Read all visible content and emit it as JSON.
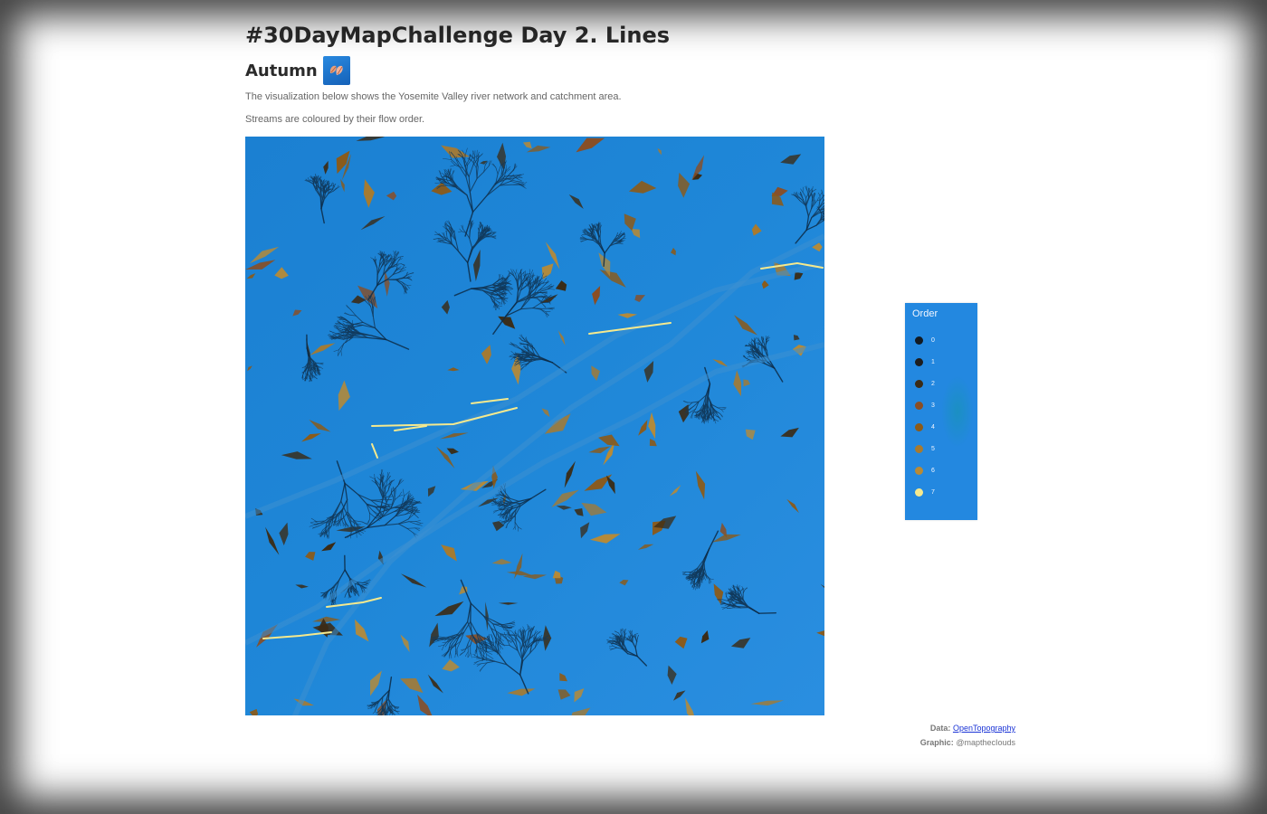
{
  "header": {
    "title": "#30DayMapChallenge Day 2. Lines",
    "subtitle": "Autumn",
    "badge_icon": "autumn-leaves-icon"
  },
  "description": {
    "line1": "The visualization below shows the Yosemite Valley river network and catchment area.",
    "line2": "Streams are coloured by their flow order."
  },
  "map": {
    "subject": "Yosemite Valley river network",
    "background_color": "#1f85d6",
    "stream_color": "#0f3450"
  },
  "legend": {
    "title": "Order",
    "items": [
      {
        "label": "0",
        "color": "#121a22"
      },
      {
        "label": "1",
        "color": "#1d1d1d"
      },
      {
        "label": "2",
        "color": "#3b2b15"
      },
      {
        "label": "3",
        "color": "#8a4e24"
      },
      {
        "label": "4",
        "color": "#8c5a18"
      },
      {
        "label": "5",
        "color": "#a87a2e"
      },
      {
        "label": "6",
        "color": "#b88a35"
      },
      {
        "label": "7",
        "color": "#f5e98e"
      }
    ]
  },
  "credits": {
    "data_label": "Data:",
    "data_link": "OpenTopography",
    "graphic_label": "Graphic:",
    "graphic_value": "@mapthecIouds"
  }
}
